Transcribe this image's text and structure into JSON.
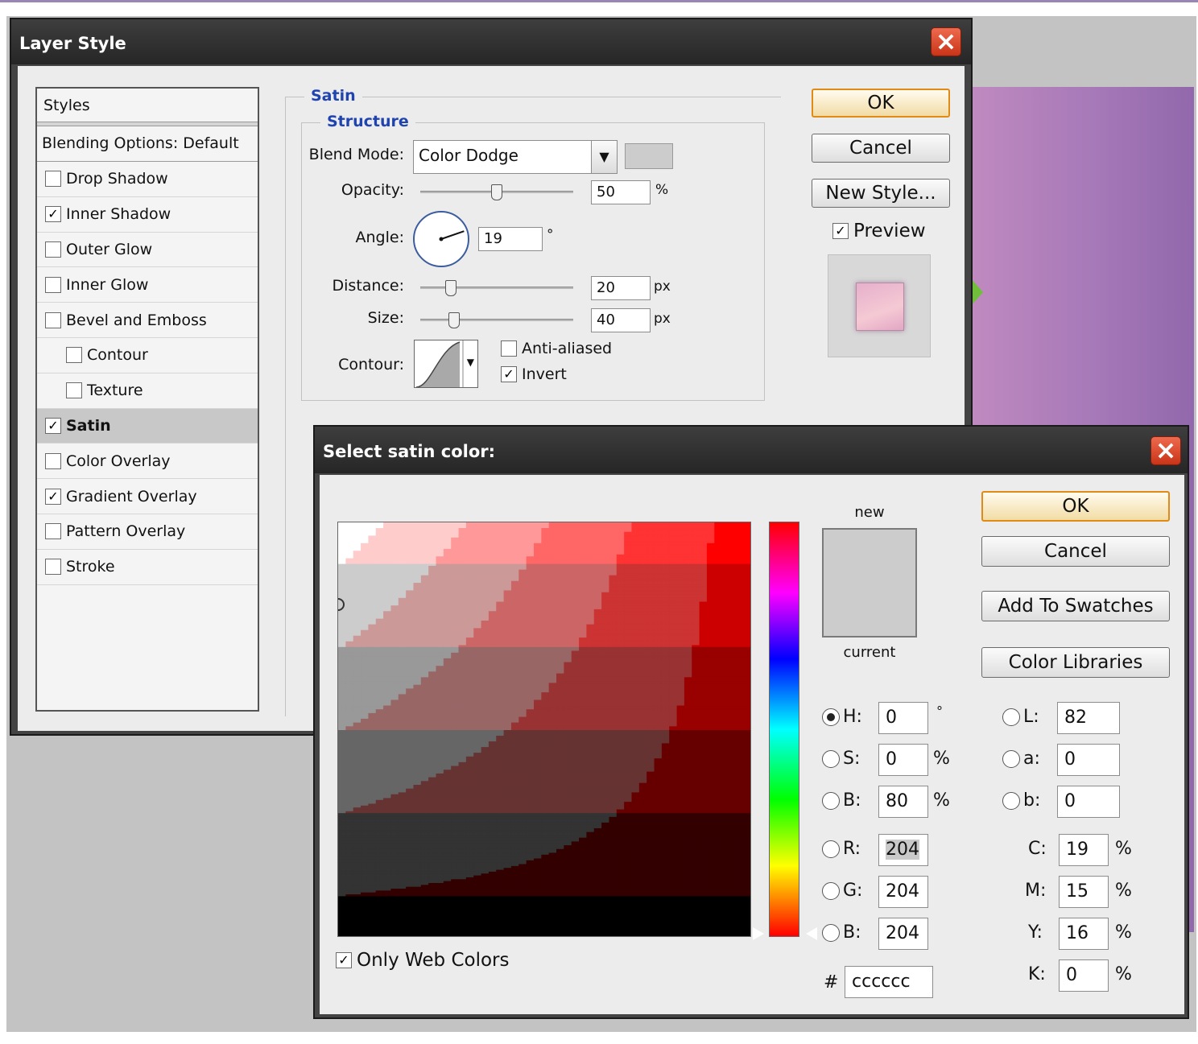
{
  "layer_style": {
    "title": "Layer Style",
    "styles_list": {
      "header": "Styles",
      "blending": "Blending Options: Default",
      "items": [
        {
          "label": "Drop Shadow",
          "checked": false,
          "sub": false
        },
        {
          "label": "Inner Shadow",
          "checked": true,
          "sub": false
        },
        {
          "label": "Outer Glow",
          "checked": false,
          "sub": false
        },
        {
          "label": "Inner Glow",
          "checked": false,
          "sub": false
        },
        {
          "label": "Bevel and Emboss",
          "checked": false,
          "sub": false
        },
        {
          "label": "Contour",
          "checked": false,
          "sub": true
        },
        {
          "label": "Texture",
          "checked": false,
          "sub": true
        },
        {
          "label": "Satin",
          "checked": true,
          "sub": false,
          "active": true
        },
        {
          "label": "Color Overlay",
          "checked": false,
          "sub": false
        },
        {
          "label": "Gradient Overlay",
          "checked": true,
          "sub": false
        },
        {
          "label": "Pattern Overlay",
          "checked": false,
          "sub": false
        },
        {
          "label": "Stroke",
          "checked": false,
          "sub": false
        }
      ]
    },
    "satin": {
      "group_title": "Satin",
      "structure_title": "Structure",
      "blend_mode_label": "Blend Mode:",
      "blend_mode_value": "Color Dodge",
      "opacity_label": "Opacity:",
      "opacity_value": "50",
      "opacity_unit": "%",
      "opacity_fraction": 0.5,
      "angle_label": "Angle:",
      "angle_value": "19",
      "angle_unit": "°",
      "distance_label": "Distance:",
      "distance_value": "20",
      "distance_unit": "px",
      "distance_fraction": 0.2,
      "size_label": "Size:",
      "size_value": "40",
      "size_unit": "px",
      "size_fraction": 0.22,
      "contour_label": "Contour:",
      "anti_aliased_label": "Anti-aliased",
      "anti_aliased": false,
      "invert_label": "Invert",
      "invert": true,
      "swatch_color": "#cccccc"
    },
    "buttons": {
      "ok": "OK",
      "cancel": "Cancel",
      "new_style": "New Style...",
      "preview_label": "Preview",
      "preview": true
    }
  },
  "color_picker": {
    "title": "Select satin color:",
    "new_label": "new",
    "current_label": "current",
    "new_color": "#cccccc",
    "current_color": "#cccccc",
    "only_web_colors_label": "Only Web Colors",
    "only_web_colors": true,
    "buttons": {
      "ok": "OK",
      "cancel": "Cancel",
      "add_to_swatches": "Add To Swatches",
      "color_libraries": "Color Libraries"
    },
    "hsb": [
      {
        "label": "H:",
        "value": "0",
        "unit": "°",
        "selected": true
      },
      {
        "label": "S:",
        "value": "0",
        "unit": "%",
        "selected": false
      },
      {
        "label": "B:",
        "value": "80",
        "unit": "%",
        "selected": false
      }
    ],
    "rgb": [
      {
        "label": "R:",
        "value": "204",
        "selected": false
      },
      {
        "label": "G:",
        "value": "204",
        "selected": false
      },
      {
        "label": "B:",
        "value": "204",
        "selected": false
      }
    ],
    "lab": [
      {
        "label": "L:",
        "value": "82"
      },
      {
        "label": "a:",
        "value": "0"
      },
      {
        "label": "b:",
        "value": "0"
      }
    ],
    "cmyk": [
      {
        "label": "C:",
        "value": "19",
        "unit": "%"
      },
      {
        "label": "M:",
        "value": "15",
        "unit": "%"
      },
      {
        "label": "Y:",
        "value": "16",
        "unit": "%"
      },
      {
        "label": "K:",
        "value": "0",
        "unit": "%"
      }
    ],
    "hex_label": "#",
    "hex_value": "cccccc",
    "hue_color": "#ff0000"
  }
}
